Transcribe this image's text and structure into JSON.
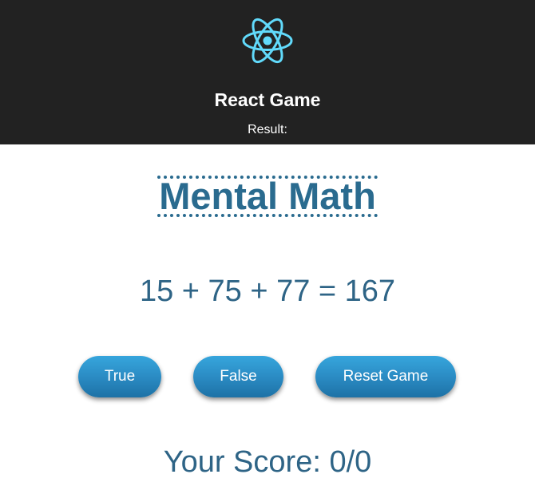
{
  "header": {
    "logo_icon": "react-atom-icon",
    "logo_color": "#61dafb",
    "title": "React Game",
    "result_label": "Result:"
  },
  "main": {
    "heading": "Mental Math",
    "equation": "15 + 75 + 77 = 167",
    "buttons": {
      "true_label": "True",
      "false_label": "False",
      "reset_label": "Reset Game"
    },
    "score": "Your Score: 0/0"
  },
  "colors": {
    "header_bg": "#222222",
    "text_blue": "#2e6486",
    "button_blue": "#2b8cc4"
  }
}
